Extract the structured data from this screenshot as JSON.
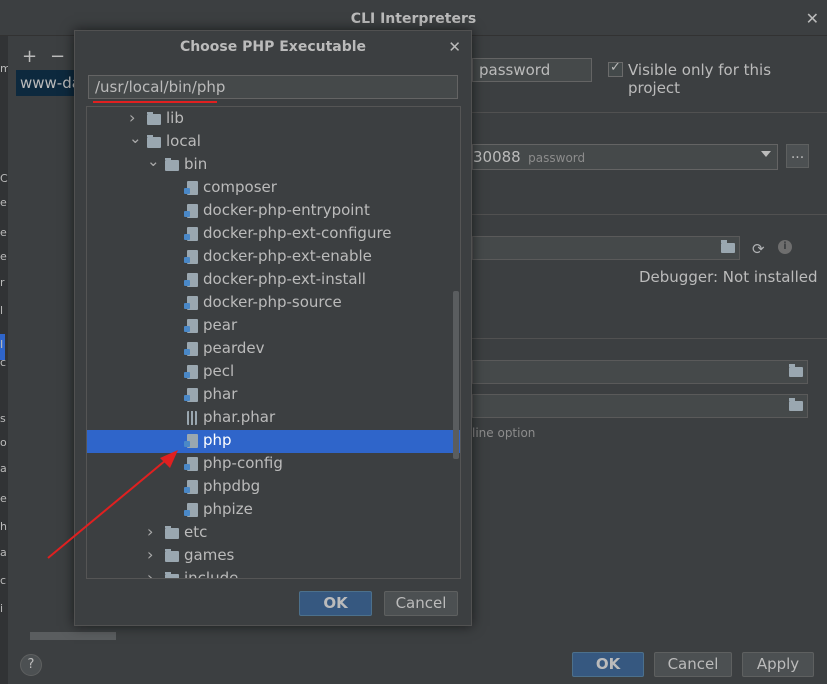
{
  "background_window": {
    "title": "CLI Interpreters",
    "close_glyph": "✕",
    "strip_chars": [
      "m",
      "C",
      "e",
      "e",
      "e",
      "r",
      "l",
      "I",
      "c",
      "s",
      "o",
      "a",
      "e",
      "h",
      "a",
      "c",
      "i"
    ],
    "add_glyph": "+",
    "remove_glyph": "−",
    "interpreter_item": "www-data",
    "name_value": "password",
    "visible_only_label": "Visible only for this project",
    "visible_only_checked": true,
    "server_value": "30088",
    "server_hint": "password",
    "server_browse_glyph": "...",
    "debugger_label": "Debugger:  Not installed",
    "cmd_hint": "line option",
    "help_glyph": "?",
    "ok_label": "OK",
    "cancel_label": "Cancel",
    "apply_label": "Apply"
  },
  "dialog": {
    "title": "Choose PHP Executable",
    "close_glyph": "✕",
    "path_value": "/usr/local/bin/php",
    "tree": [
      {
        "label": "lib",
        "type": "folder",
        "expanded": false,
        "depth": 2
      },
      {
        "label": "local",
        "type": "folder",
        "expanded": true,
        "depth": 2
      },
      {
        "label": "bin",
        "type": "folder",
        "expanded": true,
        "depth": 3
      },
      {
        "label": "composer",
        "type": "file",
        "depth": 4
      },
      {
        "label": "docker-php-entrypoint",
        "type": "file",
        "depth": 4
      },
      {
        "label": "docker-php-ext-configure",
        "type": "file",
        "depth": 4
      },
      {
        "label": "docker-php-ext-enable",
        "type": "file",
        "depth": 4
      },
      {
        "label": "docker-php-ext-install",
        "type": "file",
        "depth": 4
      },
      {
        "label": "docker-php-source",
        "type": "file",
        "depth": 4
      },
      {
        "label": "pear",
        "type": "file",
        "depth": 4
      },
      {
        "label": "peardev",
        "type": "file",
        "depth": 4
      },
      {
        "label": "pecl",
        "type": "file",
        "depth": 4
      },
      {
        "label": "phar",
        "type": "file",
        "depth": 4
      },
      {
        "label": "phar.phar",
        "type": "archive",
        "depth": 4
      },
      {
        "label": "php",
        "type": "file",
        "depth": 4,
        "selected": true
      },
      {
        "label": "php-config",
        "type": "file",
        "depth": 4
      },
      {
        "label": "phpdbg",
        "type": "file",
        "depth": 4
      },
      {
        "label": "phpize",
        "type": "file",
        "depth": 4
      },
      {
        "label": "etc",
        "type": "folder",
        "expanded": false,
        "depth": 3
      },
      {
        "label": "games",
        "type": "folder",
        "expanded": false,
        "depth": 3
      },
      {
        "label": "include",
        "type": "folder",
        "expanded": false,
        "depth": 3
      }
    ],
    "ok_label": "OK",
    "cancel_label": "Cancel"
  },
  "colors": {
    "selection": "#2f65ca",
    "annotation_red": "#e02020",
    "default_button": "#365880"
  }
}
